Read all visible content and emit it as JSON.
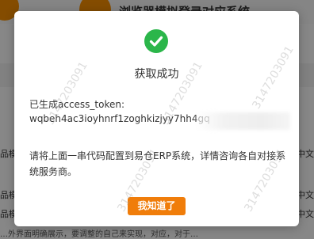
{
  "background": {
    "header_title": "浏览器模拟登录对应系统",
    "rows": [
      {
        "left": "品模",
        "right": "中文"
      },
      {
        "left": "品模",
        "right": "中文"
      },
      {
        "left": "品模",
        "right": "中文"
      }
    ],
    "bottom_text": "…外界面明确展示，要调整的自己来实现，对应，对于…"
  },
  "watermark": {
    "text": "3147203091"
  },
  "dialog": {
    "title": "获取成功",
    "token_label": "已生成access_token:",
    "token_value": "wqbeh4ac3ioyhnrf1zoghkizjyy7hh4gq",
    "description": "请将上面一串代码配置到易仓ERP系统，详情咨询各自对接系统服务商。",
    "ok_button": "我知道了",
    "success_icon": "check-circle-icon",
    "colors": {
      "success": "#2bb64a",
      "button": "#f07d0a"
    }
  }
}
